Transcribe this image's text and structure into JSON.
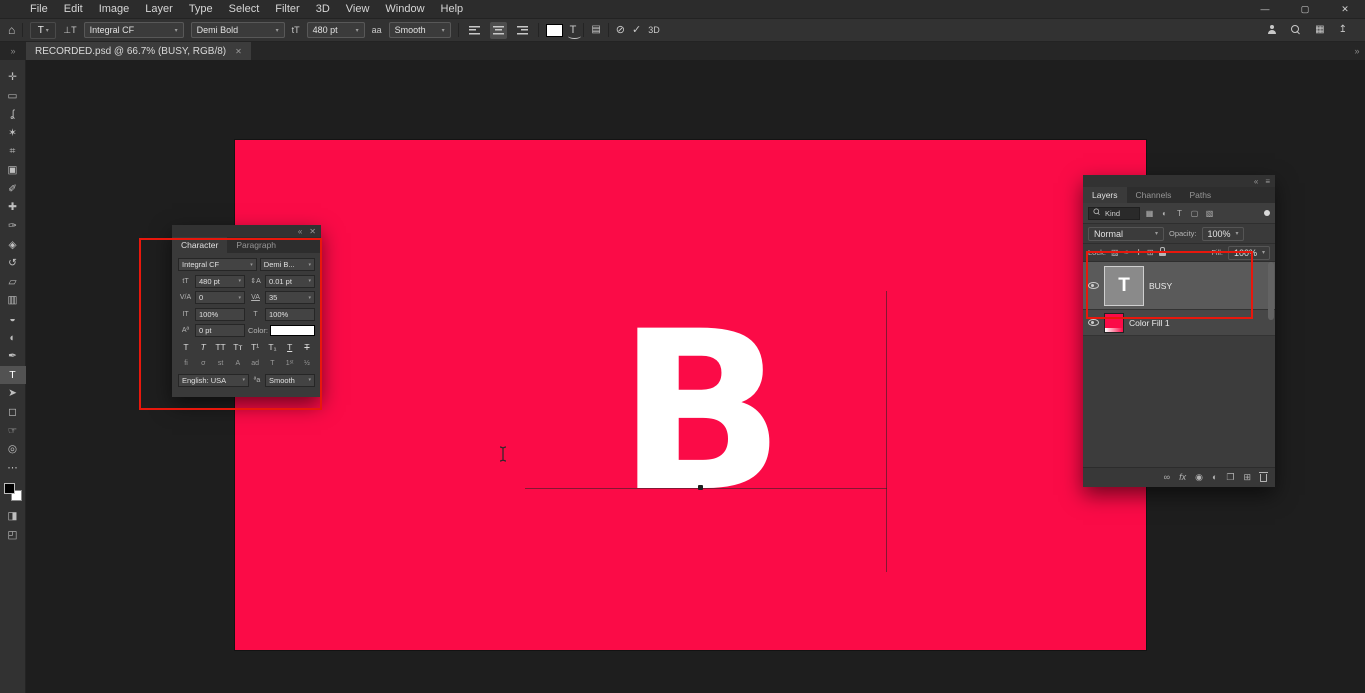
{
  "menubar": {
    "items": [
      "File",
      "Edit",
      "Image",
      "Layer",
      "Type",
      "Select",
      "Filter",
      "3D",
      "View",
      "Window",
      "Help"
    ]
  },
  "window": {
    "minimize": "—",
    "maximize": "▢",
    "close": "✕"
  },
  "options": {
    "home_icon": "⌂",
    "tool_icon": "T",
    "orientation_icon": "⊥T",
    "font_family": "Integral CF",
    "font_style": "Demi Bold",
    "size_icon": "tT",
    "font_size": "480 pt",
    "aa_icon": "aa",
    "anti_alias": "Smooth",
    "warp_icon": "T",
    "panels_icon": "▤",
    "cancel_icon": "⊘",
    "commit_icon": "✓",
    "threed_label": "3D",
    "grid_icon": "▦",
    "share_icon": "↥"
  },
  "tab": {
    "title": "RECORDED.psd @ 66.7% (BUSY, RGB/8)",
    "close": "✕",
    "left_chevron": "»",
    "right_chevron": "»"
  },
  "tools": [
    {
      "name": "move-tool",
      "glyph": "✛"
    },
    {
      "name": "marquee-tool",
      "glyph": "▭"
    },
    {
      "name": "lasso-tool",
      "glyph": "ʆ"
    },
    {
      "name": "magic-wand-tool",
      "glyph": "✶"
    },
    {
      "name": "crop-tool",
      "glyph": "⌗"
    },
    {
      "name": "frame-tool",
      "glyph": "▣"
    },
    {
      "name": "eyedropper-tool",
      "glyph": "✐"
    },
    {
      "name": "healing-brush-tool",
      "glyph": "✚"
    },
    {
      "name": "brush-tool",
      "glyph": "✑"
    },
    {
      "name": "clone-stamp-tool",
      "glyph": "◈"
    },
    {
      "name": "history-brush-tool",
      "glyph": "↺"
    },
    {
      "name": "eraser-tool",
      "glyph": "▱"
    },
    {
      "name": "gradient-tool",
      "glyph": "▥"
    },
    {
      "name": "blur-tool",
      "glyph": "◒"
    },
    {
      "name": "dodge-tool",
      "glyph": "◐"
    },
    {
      "name": "pen-tool",
      "glyph": "✒"
    },
    {
      "name": "type-tool",
      "glyph": "T"
    },
    {
      "name": "path-selection-tool",
      "glyph": "➤"
    },
    {
      "name": "shape-tool",
      "glyph": "◻"
    },
    {
      "name": "hand-tool",
      "glyph": "☞"
    },
    {
      "name": "zoom-tool",
      "glyph": "◎"
    },
    {
      "name": "more-tools",
      "glyph": "⋯"
    },
    {
      "name": "quick-mask",
      "glyph": "◨"
    },
    {
      "name": "screen-mode",
      "glyph": "◰"
    }
  ],
  "canvas": {
    "letter": "B"
  },
  "character_panel": {
    "collapse_icon": "«",
    "close_icon": "✕",
    "tabs": [
      "Character",
      "Paragraph"
    ],
    "font_family": "Integral CF",
    "font_style": "Demi B...",
    "size_icon": "tT",
    "size": "480 pt",
    "leading_icon": "⇕A",
    "leading": "0.01 pt",
    "kerning_icon": "V/A",
    "kerning": "0",
    "tracking_icon": "VA",
    "tracking": "35",
    "vscale_icon": "IT",
    "vscale": "100%",
    "hscale_icon": "T",
    "hscale": "100%",
    "baseline_icon": "Aª",
    "baseline": "0 pt",
    "color_label": "Color:",
    "format_buttons": [
      "T",
      "T",
      "TT",
      "Tᴛ",
      "T¹",
      "T₁",
      "T",
      "T"
    ],
    "ligature_buttons": [
      "fi",
      "σ",
      "st",
      "A",
      "ad",
      "T",
      "1ˢᵗ",
      "½"
    ],
    "language": "English: USA",
    "aa_icon": "ªa",
    "anti_alias": "Smooth"
  },
  "layers_panel": {
    "collapse_icon": "«",
    "menu_icon": "≡",
    "tabs": [
      "Layers",
      "Channels",
      "Paths"
    ],
    "filter_label": "Kind",
    "filter_icons": [
      "▦",
      "◐",
      "T",
      "▢",
      "▧"
    ],
    "blend_mode": "Normal",
    "opacity_label": "Opacity:",
    "opacity": "100%",
    "lock_label": "Lock:",
    "lock_icons": [
      "▨",
      "✑",
      "✛",
      "⊞"
    ],
    "fill_label": "Fill:",
    "fill": "100%",
    "layers": [
      {
        "name": "BUSY",
        "thumb": "T"
      },
      {
        "name": "Color Fill 1"
      }
    ],
    "bottom_icons": [
      "∞",
      "fx",
      "◉",
      "◐",
      "❐",
      "⊞"
    ]
  },
  "ui": {
    "caret": "▾"
  },
  "colors": {
    "artboard": "#fb0b47",
    "annotation": "#e8170c"
  }
}
